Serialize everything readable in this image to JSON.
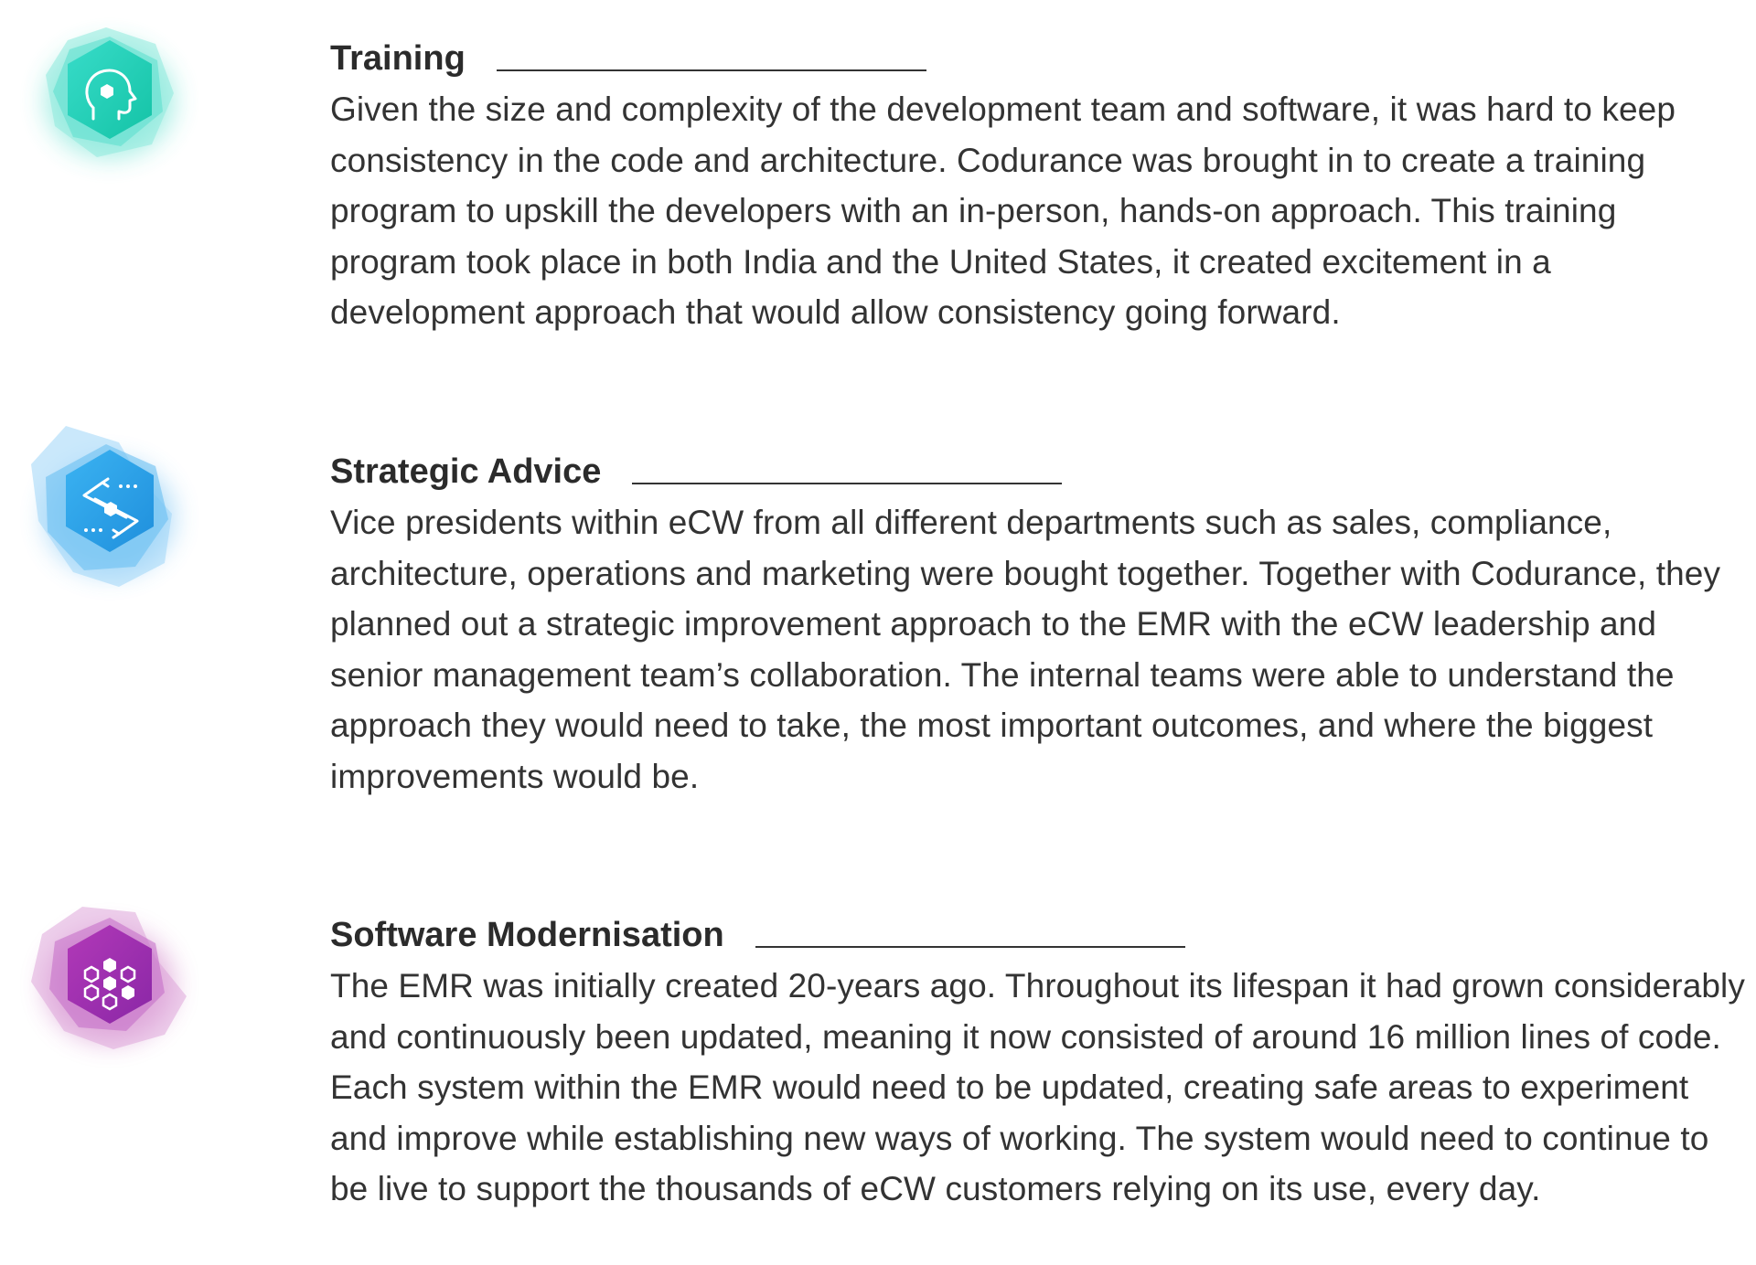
{
  "sections": [
    {
      "id": "training",
      "icon": "head-gear-icon",
      "accent": "#1fcdb4",
      "title": "Training",
      "body": "Given the size and complexity of the development team and software, it was hard to keep consistency in the code and architecture. Codurance was brought in to create a training program to upskill the developers with an in-person, hands-on approach. This training program took place in both India and the United States, it created excitement in a development approach that would allow consistency going forward."
    },
    {
      "id": "strategic-advice",
      "icon": "strategy-arrows-icon",
      "accent": "#2b9fe6",
      "title": "Strategic Advice",
      "body": "Vice presidents within eCW from all different departments such as sales, compliance, architecture, operations and marketing were bought together. Together with Codurance, they planned out a strategic improvement approach to the EMR with the eCW leadership and senior management team’s collaboration. The internal teams were able to understand the approach they would need to take, the most important outcomes, and where the biggest improvements would be."
    },
    {
      "id": "software-modernisation",
      "icon": "hexagon-cluster-icon",
      "accent": "#9b2fae",
      "title": "Software Modernisation",
      "body": "The EMR was initially created 20-years ago. Throughout its lifespan it had grown considerably and continuously been updated, meaning it now consisted of around 16 million lines of code. Each system within the EMR would need to be updated, creating safe areas to experiment and improve while establishing new ways of working. The system would need to continue to be live to support the thousands of eCW customers relying on its use, every day."
    }
  ]
}
